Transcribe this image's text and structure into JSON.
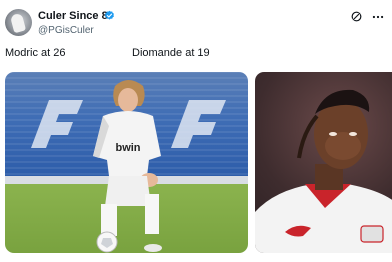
{
  "tweet": {
    "author_name": "Culer Since 8",
    "handle": "@PGisCuler",
    "verified": true,
    "caption_left": "Modric at 26",
    "caption_right": "Diomande at 19",
    "images": [
      {
        "jersey_text": "bwin"
      },
      {
        "jersey_text": ""
      }
    ]
  },
  "icons": {
    "avatar": "avatar",
    "verified": "verified-badge-icon",
    "grok": "grok-icon",
    "more": "more-options-icon"
  },
  "colors": {
    "verified_blue": "#1d9bf0",
    "text_primary": "#0f1419",
    "text_secondary": "#536471"
  }
}
